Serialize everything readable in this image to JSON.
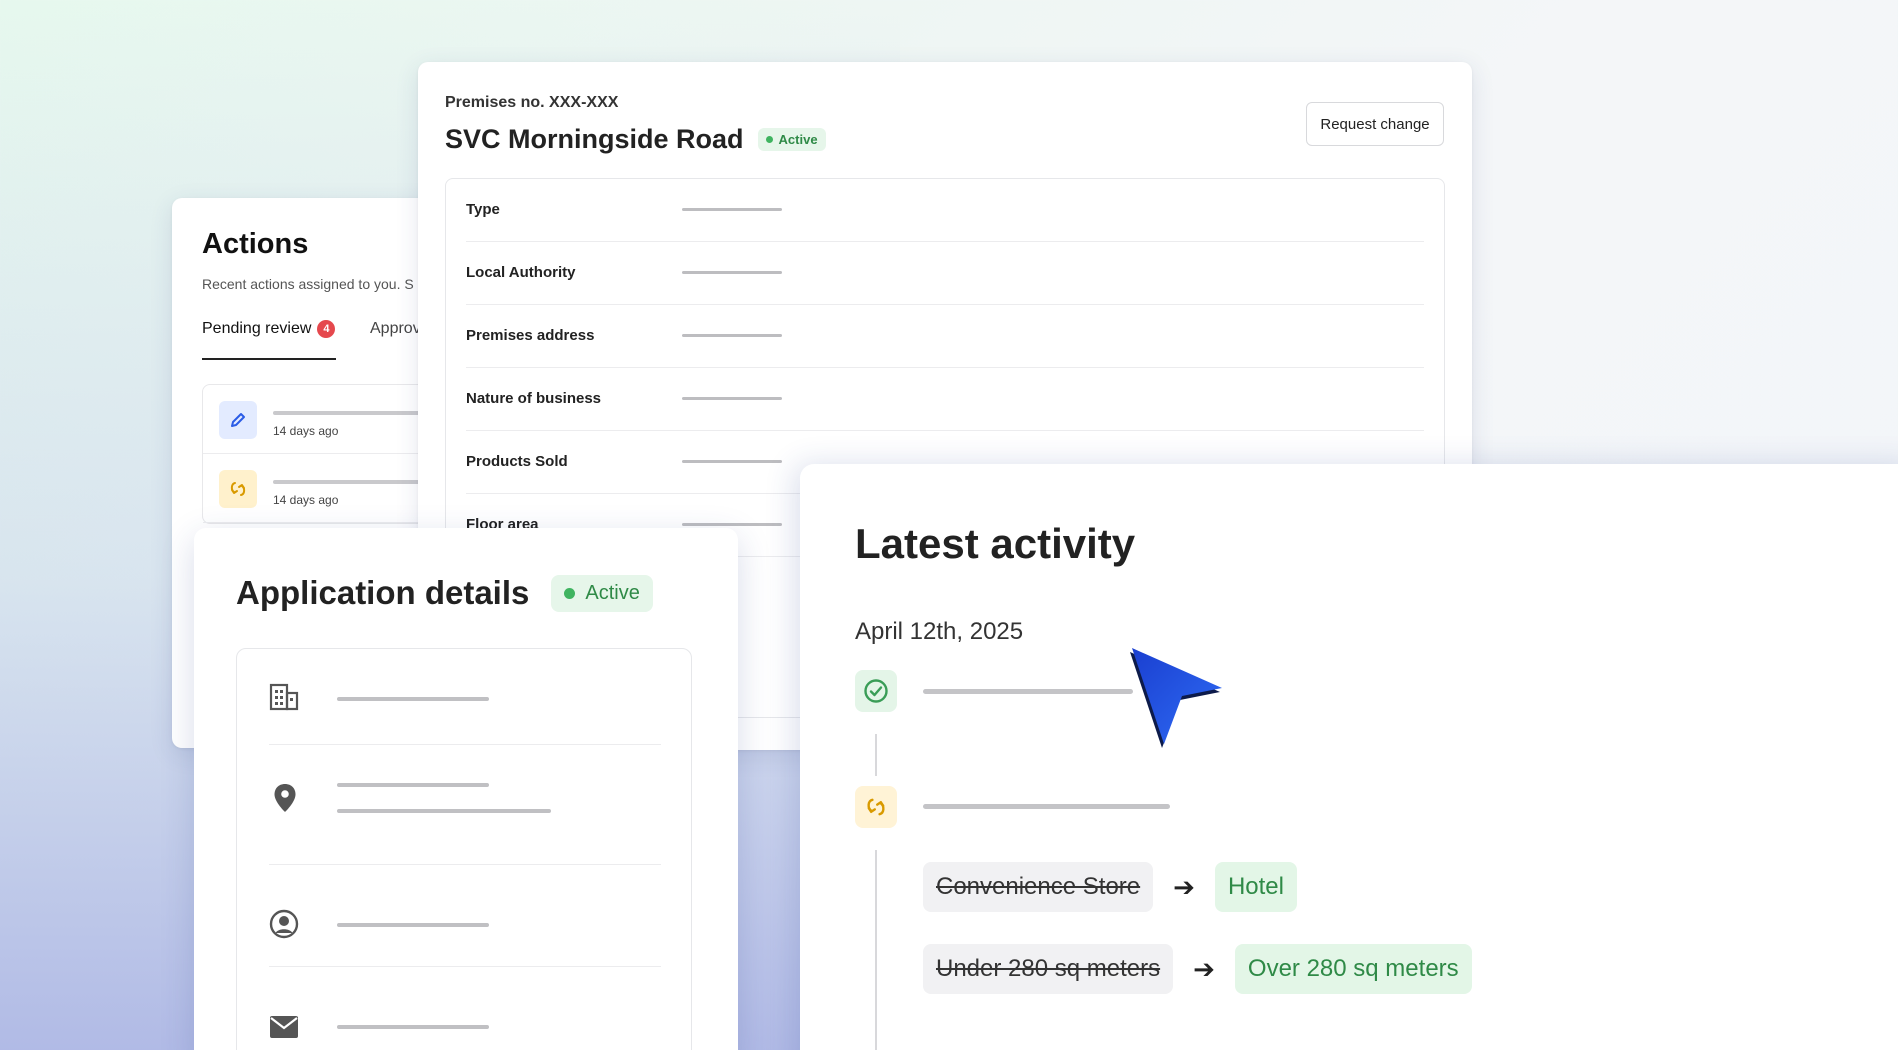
{
  "actions": {
    "title": "Actions",
    "subtitle": "Recent actions assigned to you. S",
    "tabs": [
      {
        "label": "Pending review",
        "count": "4"
      },
      {
        "label": "Approv"
      }
    ],
    "items": [
      {
        "icon": "pencil-icon",
        "meta": "14 days ago"
      },
      {
        "icon": "swap-icon",
        "meta": "14 days ago"
      }
    ]
  },
  "premises": {
    "number": "Premises no. XXX-XXX",
    "name": "SVC Morningside Road",
    "status": "Active",
    "request_change_label": "Request change",
    "fields": [
      "Type",
      "Local Authority",
      "Premises address",
      "Nature of business",
      "Products Sold",
      "Floor area"
    ]
  },
  "application_details": {
    "title": "Application details",
    "status": "Active",
    "rows": [
      {
        "icon": "building-icon"
      },
      {
        "icon": "location-pin-icon"
      },
      {
        "icon": "user-circle-icon"
      },
      {
        "icon": "mail-icon"
      }
    ]
  },
  "latest_activity": {
    "title": "Latest activity",
    "date": "April 12th, 2025",
    "events": [
      {
        "icon": "check-circle-icon"
      },
      {
        "icon": "swap-icon"
      }
    ],
    "changes": [
      {
        "from": "Convenience Store",
        "to": "Hotel"
      },
      {
        "from": "Under 280 sq meters",
        "to": "Over 280 sq meters"
      }
    ]
  },
  "colors": {
    "accent": "#1f4fd6",
    "active_green": "#2f8a47",
    "active_bg": "#e6f6ea",
    "badge_red": "#e5484d"
  }
}
